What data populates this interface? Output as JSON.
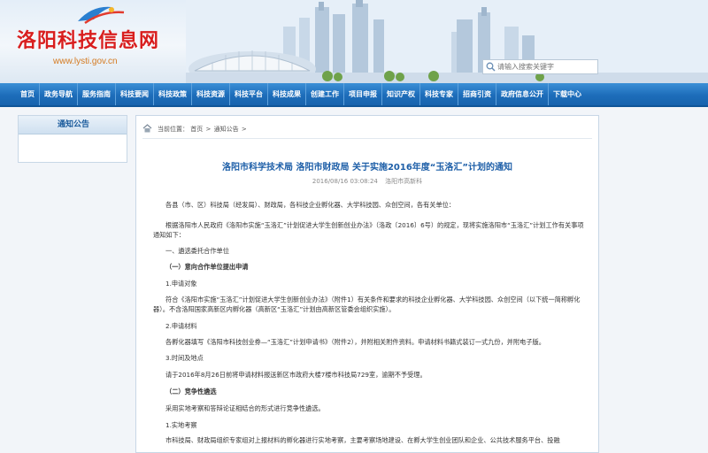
{
  "site": {
    "name": "洛阳科技信息网",
    "url": "www.lysti.gov.cn",
    "search_placeholder": "请输入搜索关键字"
  },
  "nav": [
    "首页",
    "政务导航",
    "服务指南",
    "科技要闻",
    "科技政策",
    "科技资源",
    "科技平台",
    "科技成果",
    "创建工作",
    "项目申报",
    "知识产权",
    "科技专家",
    "招商引资",
    "政府信息公开",
    "下载中心"
  ],
  "sidebar": {
    "title": "通知公告"
  },
  "breadcrumb": {
    "prefix": "当前位置：",
    "home": "首页",
    "sep1": ">",
    "current": "通知公告",
    "sep2": ">"
  },
  "article": {
    "title": "洛阳市科学技术局 洛阳市财政局 关于实施2016年度“玉洛汇”计划的通知",
    "date": "2016/08/16 03:08:24",
    "source": "洛阳市高新科",
    "paragraphs": [
      "各县（市、区）科技局（经发局）、财政局，各科技企业孵化器、大学科技园、众创空间，各有关单位：",
      "根据洛阳市人民政府《洛阳市实施“玉洛汇”计划促进大学生创新创业办法》（洛政〔2016〕6号）的规定，现将实施洛阳市“玉洛汇”计划工作有关事项通知如下：",
      "一、遴选委托合作单位",
      "（一）意向合作单位提出申请",
      "1.申请对象",
      "符合《洛阳市实施“玉洛汇”计划促进大学生创新创业办法》（附件1）有关条件和要求的科技企业孵化器、大学科技园、众创空间（以下统一简称孵化器）。不含洛阳国家高新区内孵化器（高新区“玉洛汇”计划由高新区管委会组织实施）。",
      "2.申请材料",
      "各孵化器填写《洛阳市科技创业券—“玉洛汇”计划申请书》（附件2），并附相关附件资料。申请材料书籍式装订一式九份，并附电子版。",
      "3.时间及地点",
      "请于2016年8月26日前将申请材料报送新区市政府大楼7楼市科技局729室，逾期不予受理。",
      "（二）竞争性遴选",
      "采用实地考察和答辩论证相结合的形式进行竞争性遴选。",
      "1.实地考察",
      "市科技局、财政局组织专家组对上报材料的孵化器进行实地考察，主要考察场地建设、在孵大学生创业团队和企业、公共技术服务平台、投融"
    ]
  }
}
